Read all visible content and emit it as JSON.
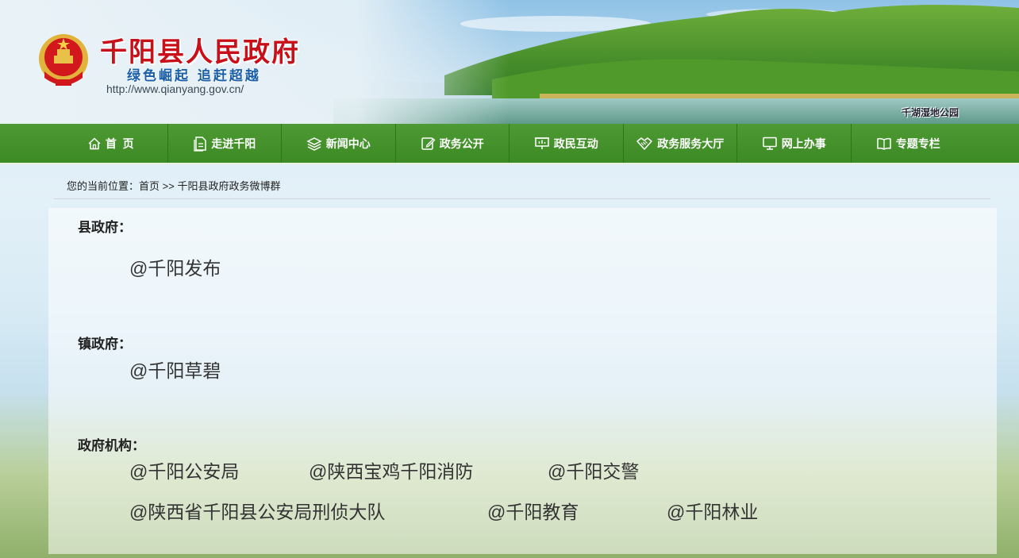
{
  "header": {
    "site_title": "千阳县人民政府",
    "slogan": "绿色崛起 追赶超越",
    "url": "http://www.qianyang.gov.cn/",
    "photo_caption": "千湖湿地公园"
  },
  "nav": {
    "items": [
      {
        "label": "首  页",
        "icon": "home-icon"
      },
      {
        "label": "走进千阳",
        "icon": "document-icon"
      },
      {
        "label": "新闻中心",
        "icon": "layers-icon"
      },
      {
        "label": "政务公开",
        "icon": "edit-icon"
      },
      {
        "label": "政民互动",
        "icon": "presentation-icon"
      },
      {
        "label": "政务服务大厅",
        "icon": "handshake-icon"
      },
      {
        "label": "网上办事",
        "icon": "monitor-icon"
      },
      {
        "label": "专题专栏",
        "icon": "book-icon"
      }
    ]
  },
  "breadcrumb": {
    "prefix": "您的当前位置：",
    "home": "首页",
    "separator": " >> ",
    "current": "千阳县政府政务微博群"
  },
  "sections": {
    "county": {
      "title": "县政府：",
      "links": [
        "@千阳发布"
      ]
    },
    "town": {
      "title": "镇政府：",
      "links": [
        "@千阳草碧"
      ]
    },
    "agencies": {
      "title": "政府机构：",
      "links": [
        "@千阳公安局",
        "@陕西宝鸡千阳消防",
        "@千阳交警",
        "@陕西省千阳县公安局刑侦大队",
        "@千阳教育",
        "@千阳林业"
      ]
    }
  },
  "colors": {
    "nav_green": "#3f8d27",
    "title_red": "#c8101a",
    "slogan_blue": "#1a5fa8"
  }
}
